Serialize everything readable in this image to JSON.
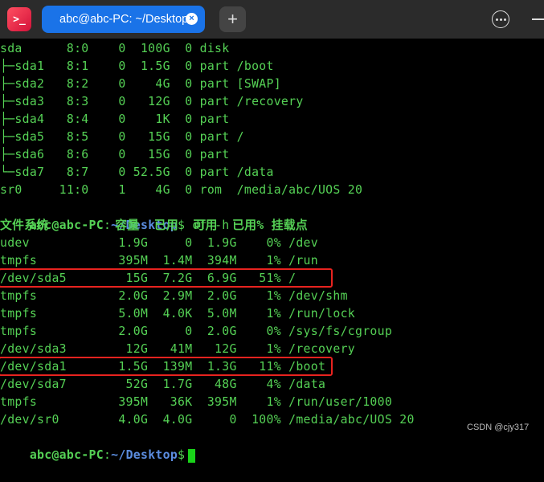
{
  "titlebar": {
    "app_icon": ">_",
    "tab_title": "abc@abc-PC: ~/Desktop",
    "tab_close": "×",
    "new_tab": "+",
    "menu_icon": "more-options-icon"
  },
  "terminal": {
    "lines": [
      "sda      8:0    0  100G  0 disk",
      "├─sda1   8:1    0  1.5G  0 part /boot",
      "├─sda2   8:2    0    4G  0 part [SWAP]",
      "├─sda3   8:3    0   12G  0 part /recovery",
      "├─sda4   8:4    0    1K  0 part",
      "├─sda5   8:5    0   15G  0 part /",
      "├─sda6   8:6    0   15G  0 part",
      "└─sda7   8:7    0 52.5G  0 part /data",
      "sr0     11:0    1    4G  0 rom  /media/abc/UOS 20"
    ],
    "prompt1": {
      "user": "abc@abc-PC",
      "sep": ":",
      "path": "~/Desktop",
      "symbol": "$",
      "command": " df -h"
    },
    "df_header": "文件系统         容量  已用  可用  已用% 挂载点",
    "df_rows": [
      "udev            1.9G     0  1.9G    0% /dev",
      "tmpfs           395M  1.4M  394M    1% /run",
      "/dev/sda5        15G  7.2G  6.9G   51% /",
      "tmpfs           2.0G  2.9M  2.0G    1% /dev/shm",
      "tmpfs           5.0M  4.0K  5.0M    1% /run/lock",
      "tmpfs           2.0G     0  2.0G    0% /sys/fs/cgroup",
      "/dev/sda3        12G   41M   12G    1% /recovery",
      "/dev/sda1       1.5G  139M  1.3G   11% /boot",
      "/dev/sda7        52G  1.7G   48G    4% /data",
      "tmpfs           395M   36K  395M    1% /run/user/1000",
      "/dev/sr0        4.0G  4.0G     0  100% /media/abc/UOS 20"
    ],
    "prompt2": {
      "user": "abc@abc-PC",
      "sep": ":",
      "path": "~/Desktop",
      "symbol": "$"
    }
  },
  "watermark": "CSDN @cjy317",
  "colors": {
    "text": "#55d155",
    "path": "#5b8de0",
    "highlight": "#e8231f",
    "tab": "#1a73e8"
  }
}
